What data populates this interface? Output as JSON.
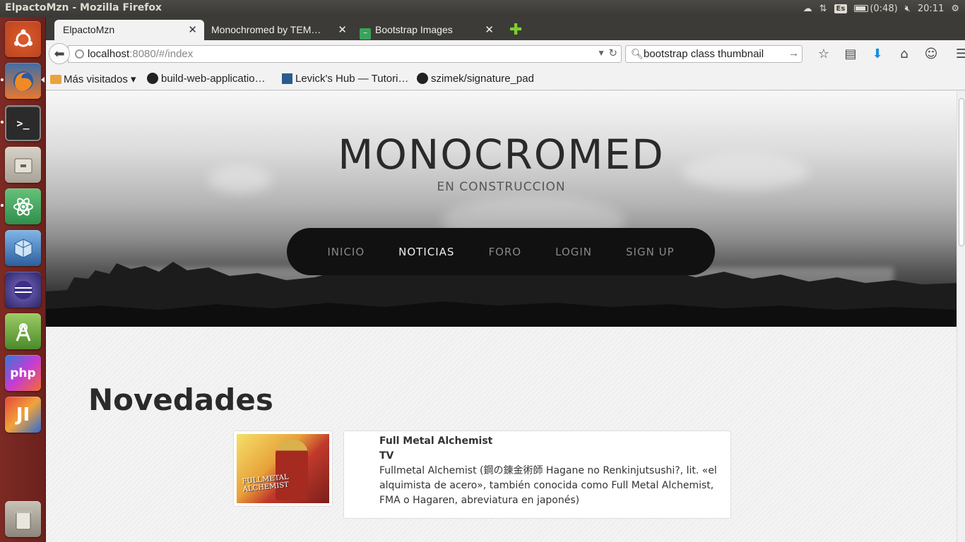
{
  "system": {
    "window_title": "ElpactoMzn - Mozilla Firefox",
    "keyboard": "Es",
    "battery": "(0:48)",
    "clock": "20:11"
  },
  "launcher": {
    "apps": [
      "ubuntu-dash",
      "firefox",
      "terminal",
      "files",
      "atom",
      "virtualbox",
      "eclipse",
      "android-studio",
      "phpstorm",
      "intellij",
      "trash"
    ]
  },
  "tabs": [
    {
      "label": "ElpactoMzn",
      "active": true
    },
    {
      "label": "Monochromed by TEM…",
      "active": false
    },
    {
      "label": "Bootstrap Images",
      "active": false
    }
  ],
  "navbar": {
    "url_host": "localhost",
    "url_path": ":8080/#/index",
    "search_query": "bootstrap class thumbnail"
  },
  "bookmarks": [
    {
      "label": "Más visitados ▾",
      "icon": "folder-icon"
    },
    {
      "label": "build-web-applicatio…",
      "icon": "github-icon"
    },
    {
      "label": "Levick's Hub — Tutori…",
      "icon": "site-icon"
    },
    {
      "label": "szimek/signature_pad",
      "icon": "github-icon"
    }
  ],
  "site": {
    "title": "MONOCROMED",
    "subtitle": "EN CONSTRUCCION",
    "menu": [
      {
        "label": "INICIO",
        "active": false
      },
      {
        "label": "NOTICIAS",
        "active": true
      },
      {
        "label": "FORO",
        "active": false
      },
      {
        "label": "LOGIN",
        "active": false
      },
      {
        "label": "SIGN UP",
        "active": false
      }
    ]
  },
  "section": {
    "heading": "Novedades",
    "item": {
      "image_logo_text": "FULLMETAL ALCHEMIST",
      "title": "Full Metal Alchemist",
      "type": "TV",
      "description": "Fullmetal Alchemist (鋼の錬金術師 Hagane no Renkinjutsushi?, lit. «el alquimista de acero», también conocida como Full Metal Alchemist, FMA o Hagaren, abreviatura en japonés)"
    }
  }
}
